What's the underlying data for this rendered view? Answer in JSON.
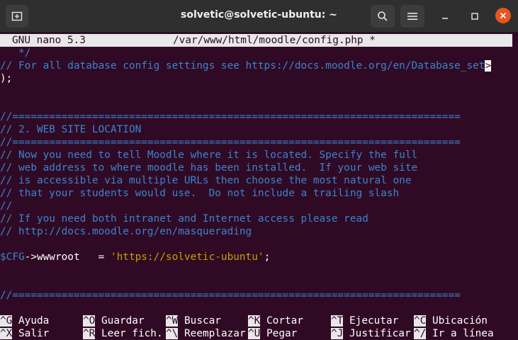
{
  "window": {
    "title": "solvetic@solvetic-ubuntu: ~"
  },
  "nano": {
    "version": "GNU nano 5.3",
    "filename": "/var/www/html/moodle/config.php *"
  },
  "lines": [
    {
      "kind": "comment",
      "text": "   */"
    },
    {
      "kind": "comment_trunc",
      "text": "// For all database config settings see https://docs.moodle.org/en/Database_set",
      "marker": ">"
    },
    {
      "kind": "plain",
      "text": ");"
    },
    {
      "kind": "blank",
      "text": ""
    },
    {
      "kind": "blank",
      "text": ""
    },
    {
      "kind": "comment",
      "text": "//========================================================================="
    },
    {
      "kind": "comment",
      "text": "// 2. WEB SITE LOCATION"
    },
    {
      "kind": "comment",
      "text": "//========================================================================="
    },
    {
      "kind": "comment",
      "text": "// Now you need to tell Moodle where it is located. Specify the full"
    },
    {
      "kind": "comment",
      "text": "// web address to where moodle has been installed.  If your web site"
    },
    {
      "kind": "comment",
      "text": "// is accessible via multiple URLs then choose the most natural one"
    },
    {
      "kind": "comment",
      "text": "// that your students would use.  Do not include a trailing slash"
    },
    {
      "kind": "comment",
      "text": "//"
    },
    {
      "kind": "comment",
      "text": "// If you need both intranet and Internet access please read"
    },
    {
      "kind": "comment",
      "text": "// http://docs.moodle.org/en/masquerading"
    },
    {
      "kind": "blank",
      "text": ""
    },
    {
      "kind": "code",
      "var": "$CFG",
      "mid": "->wwwroot   = ",
      "str": "'https://solvetic-ubuntu'",
      "end": ";"
    },
    {
      "kind": "blank",
      "text": ""
    },
    {
      "kind": "blank",
      "text": ""
    },
    {
      "kind": "comment",
      "text": "//========================================================================="
    }
  ],
  "shortcuts_row1": [
    {
      "key": "^G",
      "label": " Ayuda"
    },
    {
      "key": "^O",
      "label": " Guardar"
    },
    {
      "key": "^W",
      "label": " Buscar"
    },
    {
      "key": "^K",
      "label": " Cortar"
    },
    {
      "key": "^T",
      "label": " Ejecutar"
    },
    {
      "key": "^C",
      "label": " Ubicación"
    }
  ],
  "shortcuts_row2": [
    {
      "key": "^X",
      "label": " Salir"
    },
    {
      "key": "^R",
      "label": " Leer fich."
    },
    {
      "key": "^\\",
      "label": " Reemplazar"
    },
    {
      "key": "^U",
      "label": " Pegar"
    },
    {
      "key": "^J",
      "label": " Justificar"
    },
    {
      "key": "^/",
      "label": " Ir a línea"
    }
  ],
  "icons": {
    "new_tab": "new-tab-icon",
    "search": "search-icon",
    "menu": "hamburger-menu-icon",
    "minimize": "minimize-icon",
    "maximize": "maximize-icon",
    "close": "close-icon"
  },
  "colors": {
    "terminal_bg": "#300a24",
    "comment": "#3a83cf",
    "string": "#c4a000",
    "close_button": "#e95420"
  }
}
